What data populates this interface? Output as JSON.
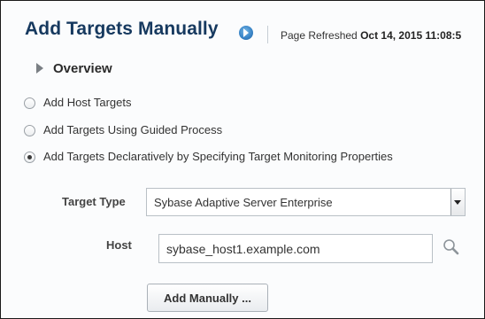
{
  "header": {
    "title": "Add Targets Manually",
    "info_icon": "info-circle-icon",
    "refreshed_label": "Page Refreshed",
    "refreshed_value": "Oct 14, 2015 11:08:5"
  },
  "overview": {
    "label": "Overview",
    "icon": "disclosure-triangle-right-icon"
  },
  "options": [
    {
      "label": "Add Host Targets",
      "selected": false
    },
    {
      "label": "Add Targets Using Guided Process",
      "selected": false
    },
    {
      "label": "Add Targets Declaratively by Specifying Target Monitoring Properties",
      "selected": true
    }
  ],
  "form": {
    "target_type_label": "Target Type",
    "target_type_value": "Sybase Adaptive Server Enterprise",
    "host_label": "Host",
    "host_value": "sybase_host1.example.com",
    "search_icon": "magnifier-icon",
    "add_button_label": "Add Manually ..."
  }
}
